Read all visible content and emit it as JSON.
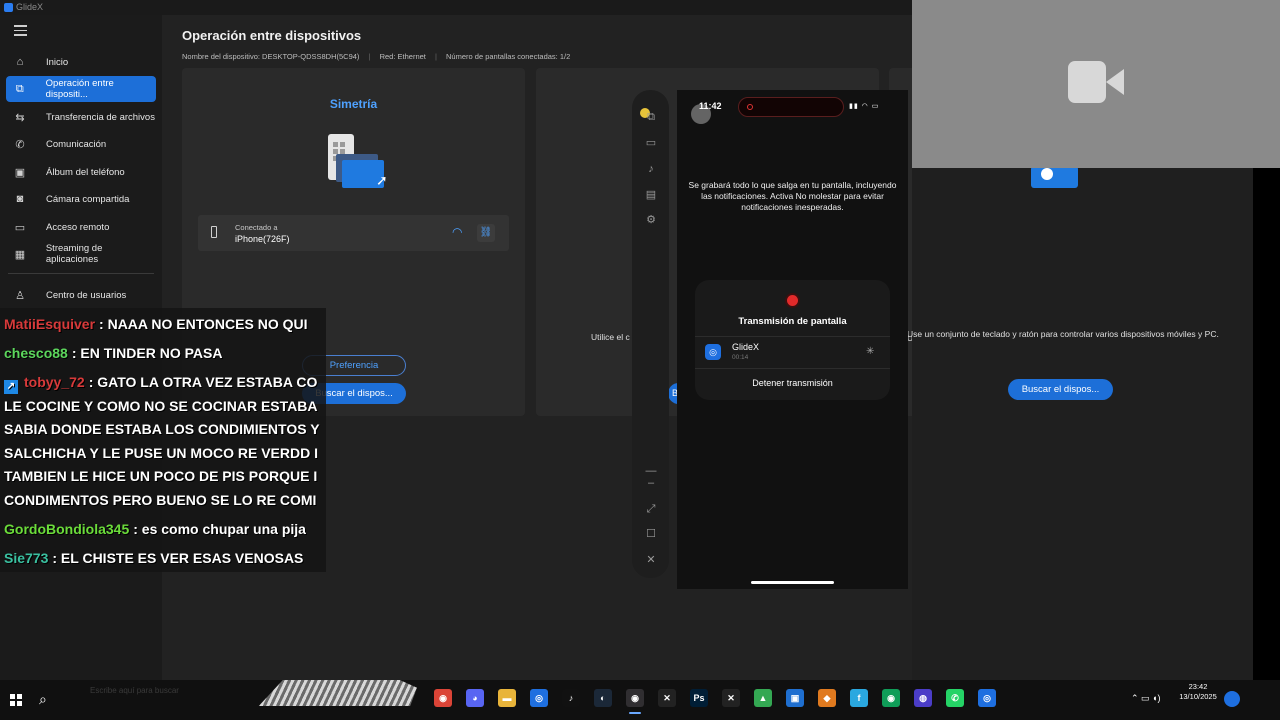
{
  "app": {
    "title": "GlideX"
  },
  "sidebar": {
    "items": [
      {
        "label": "Inicio",
        "icon": "home-icon",
        "active": false
      },
      {
        "label": "Operación entre dispositi...",
        "icon": "multi-device-icon",
        "active": true
      },
      {
        "label": "Transferencia de archivos",
        "icon": "transfer-icon",
        "active": false
      },
      {
        "label": "Comunicación",
        "icon": "phone-icon",
        "active": false
      },
      {
        "label": "Álbum del teléfono",
        "icon": "album-icon",
        "active": false
      },
      {
        "label": "Cámara compartida",
        "icon": "camera-icon",
        "active": false
      },
      {
        "label": "Acceso remoto",
        "icon": "remote-icon",
        "active": false
      },
      {
        "label": "Streaming de aplicaciones",
        "icon": "grid-icon",
        "active": false
      },
      {
        "label": "Centro de usuarios",
        "icon": "user-icon",
        "active": false
      }
    ]
  },
  "main": {
    "title": "Operación entre dispositivos",
    "info": {
      "device_name_label": "Nombre del dispositivo:",
      "device_name": "DESKTOP-QDSS8DH(5C94)",
      "network_label": "Red:",
      "network": "Ethernet",
      "screens_label": "Número de pantallas conectadas:",
      "screens": "1/2"
    },
    "card1": {
      "title": "Simetría",
      "connected_label": "Conectado a",
      "connected_device": "iPhone(726F)",
      "preference_button": "Preferencia",
      "find_button": "Buscar el dispos..."
    },
    "card2": {
      "desc_fragment": "Utilice el c",
      "desc_tail": "n",
      "button_fragment": "Bu"
    },
    "card3": {
      "desc": "Use un conjunto de teclado y ratón para controlar varios dispositivos móviles y PC.",
      "find_button": "Buscar el dispos..."
    }
  },
  "phone": {
    "time": "11:42",
    "notice": "Se grabará todo lo que salga en tu pantalla, incluyendo las notificaciones. Activa No molestar para evitar notificaciones inesperadas.",
    "sheet_title": "Transmisión de pantalla",
    "app_name": "GlideX",
    "app_elapsed": "00:14",
    "stop_label": "Detener transmisión"
  },
  "chat": {
    "messages": [
      {
        "user": "MatiiEsquiver",
        "color": "#d83a3a",
        "text": ": NAAA NO ENTONCES NO QUI"
      },
      {
        "user": "chesco88",
        "color": "#5cd65c",
        "text": ": EN TINDER NO PASA"
      },
      {
        "user": "tobyy_72",
        "color": "#d83a3a",
        "badge": true,
        "text": ": GATO LA OTRA VEZ ESTABA CO"
      }
    ],
    "continuation": [
      "LE COCINE Y COMO NO SE COCINAR ESTABA",
      "SABIA DONDE ESTABA LOS CONDIMIENTOS Y",
      "SALCHICHA Y LE PUSE UN MOCO RE VERDD I",
      "TAMBIEN LE HICE UN POCO DE PIS PORQUE I",
      "CONDIMENTOS PERO BUENO SE LO RE COMI"
    ],
    "messages2": [
      {
        "user": "GordoBondiola345",
        "color": "#6bdc3a",
        "text": ": es como chupar una pija"
      },
      {
        "user": "Sie773",
        "color": "#3ac0a0",
        "text": ": EL CHISTE ES VER ESAS VENOSAS"
      }
    ]
  },
  "taskbar": {
    "time": "23:42",
    "date": "13/10/2025",
    "search_hint": "Escribe aquí para buscar",
    "apps": [
      {
        "name": "chrome-icon",
        "glyph": "◉",
        "color": "#db4437"
      },
      {
        "name": "discord-icon",
        "glyph": "◕",
        "color": "#5865f2"
      },
      {
        "name": "folder-icon",
        "glyph": "▬",
        "color": "#e8b43a"
      },
      {
        "name": "glidex-icon",
        "glyph": "◎",
        "color": "#1e6fe0"
      },
      {
        "name": "tiktok-icon",
        "glyph": "♪",
        "color": "#111111"
      },
      {
        "name": "steam-icon",
        "glyph": "◐",
        "color": "#1b2838"
      },
      {
        "name": "obs-icon",
        "glyph": "◉",
        "color": "#302e31"
      },
      {
        "name": "capcut-icon",
        "glyph": "✕",
        "color": "#222222"
      },
      {
        "name": "photoshop-icon",
        "glyph": "Ps",
        "color": "#001e36"
      },
      {
        "name": "capcut2-icon",
        "glyph": "✕",
        "color": "#222222"
      },
      {
        "name": "drive-icon",
        "glyph": "▲",
        "color": "#34a853"
      },
      {
        "name": "explorer-icon",
        "glyph": "▣",
        "color": "#1f6fd0"
      },
      {
        "name": "browser-icon",
        "glyph": "◆",
        "color": "#e07a1f"
      },
      {
        "name": "file-icon",
        "glyph": "f",
        "color": "#2aa8e0"
      },
      {
        "name": "chrome2-icon",
        "glyph": "◉",
        "color": "#0f9d58"
      },
      {
        "name": "app-icon",
        "glyph": "◍",
        "color": "#4b3dc7"
      },
      {
        "name": "whatsapp-icon",
        "glyph": "✆",
        "color": "#25d366"
      },
      {
        "name": "glidex2-icon",
        "glyph": "◎",
        "color": "#1e6fe0"
      }
    ]
  },
  "colors": {
    "accent": "#1d6fd8",
    "link": "#4ea1ff"
  }
}
